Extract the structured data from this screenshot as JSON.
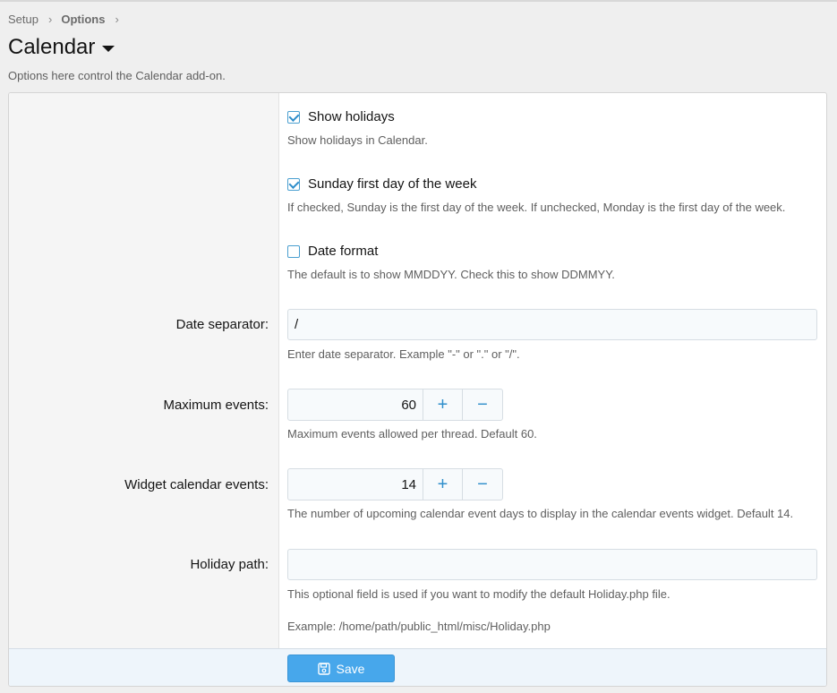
{
  "breadcrumb": {
    "items": [
      "Setup",
      "Options"
    ]
  },
  "page": {
    "title": "Calendar",
    "description": "Options here control the Calendar add-on."
  },
  "options": {
    "show_holidays": {
      "label": "Show holidays",
      "checked": true,
      "hint": "Show holidays in Calendar."
    },
    "sunday_first": {
      "label": "Sunday first day of the week",
      "checked": true,
      "hint": "If checked, Sunday is the first day of the week. If unchecked, Monday is the first day of the week."
    },
    "date_format": {
      "label": "Date format",
      "checked": false,
      "hint": "The default is to show MMDDYY. Check this to show DDMMYY."
    },
    "date_separator": {
      "label": "Date separator:",
      "value": "/",
      "hint": "Enter date separator. Example \"-\" or \".\" or \"/\"."
    },
    "max_events": {
      "label": "Maximum events:",
      "value": "60",
      "hint": "Maximum events allowed per thread. Default 60."
    },
    "widget_events": {
      "label": "Widget calendar events:",
      "value": "14",
      "hint": "The number of upcoming calendar event days to display in the calendar events widget. Default 14."
    },
    "holiday_path": {
      "label": "Holiday path:",
      "value": "",
      "hint": "This optional field is used if you want to modify the default Holiday.php file.",
      "example": "Example: /home/path/public_html/misc/Holiday.php"
    }
  },
  "stepper": {
    "plus": "+",
    "minus": "−"
  },
  "footer": {
    "save_label": "Save"
  },
  "colors": {
    "accent": "#47a7eb",
    "checkbox": "#2f8ecb"
  },
  "icons": {
    "save": "save-icon",
    "caret": "caret-down-icon",
    "chevron": "chevron-right-icon"
  }
}
